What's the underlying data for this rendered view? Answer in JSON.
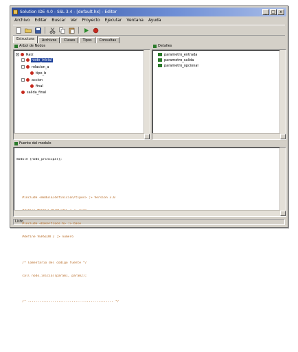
{
  "window": {
    "title": "Solution IDE 4.0 - SSL 3.4 - [default.hx] - Editor",
    "controls": [
      "_",
      "□",
      "x"
    ]
  },
  "menu": [
    "Archivo",
    "Editar",
    "Buscar",
    "Ver",
    "Proyecto",
    "Ejecutar",
    "Ventana",
    "Ayuda"
  ],
  "toolbar_icons": [
    "new-file-icon",
    "open-folder-icon",
    "save-icon",
    "cut-icon",
    "copy-icon",
    "paste-icon",
    "run-icon",
    "debug-icon"
  ],
  "tabs": [
    "Estructura",
    "Archivos",
    "Clases",
    "Tipos",
    "Consultas"
  ],
  "left_panel": {
    "title": "Arbol de Nodos",
    "tree": [
      {
        "label": "Raiz",
        "level": 0,
        "expander": "-",
        "selected": false
      },
      {
        "label": "nodo_inicial",
        "level": 1,
        "expander": "-",
        "selected": true
      },
      {
        "label": "relacion_a",
        "level": 1,
        "expander": "-",
        "selected": false
      },
      {
        "label": "tipo_b",
        "level": 2,
        "expander": "",
        "selected": false
      },
      {
        "label": "accion",
        "level": 1,
        "expander": "-",
        "selected": false
      },
      {
        "label": "final",
        "level": 2,
        "expander": "",
        "selected": false
      },
      {
        "label": "salida_final",
        "level": 1,
        "expander": "",
        "selected": false
      }
    ]
  },
  "right_panel": {
    "title": "Detalles",
    "items": [
      "parametro_entrada",
      "parametro_salida",
      "parametro_opcional"
    ]
  },
  "bottom_panel": {
    "title": "Fuente del modulo",
    "lines": [
      "module [nodo_principal];",
      "",
      "",
      "   #include <modulo/definicion/tipos> ;> Version 3.0",
      "   #define MODULO_PRINCIPAL 1 ;> modo",
      "   #include <base/tipos.h> ;> base",
      "   #define VERSION 2 ;> numero",
      "",
      "   /* Comentario del codigo fuente */",
      "   call nodo_inicial(param1, param2);",
      "",
      "   /* ............................................. */",
      "",
      "",
      ""
    ]
  },
  "status": "Listo"
}
